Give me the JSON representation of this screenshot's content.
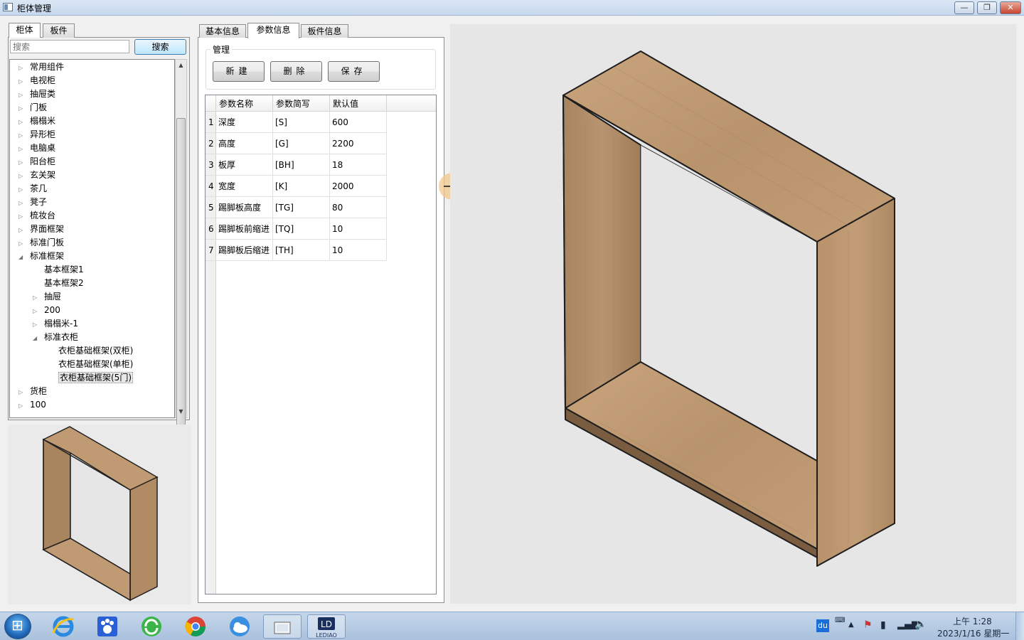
{
  "window": {
    "title": "柜体管理",
    "min_symbol": "—",
    "max_symbol": "❐",
    "close_symbol": "✕"
  },
  "left_tabs": [
    {
      "label": "柜体",
      "active": true
    },
    {
      "label": "板件",
      "active": false
    }
  ],
  "search": {
    "placeholder": "搜索",
    "button_label": "搜索"
  },
  "tree": [
    {
      "label": "常用组件",
      "level": 0,
      "state": "collapsed"
    },
    {
      "label": "电视柜",
      "level": 0,
      "state": "collapsed"
    },
    {
      "label": "抽屉类",
      "level": 0,
      "state": "collapsed"
    },
    {
      "label": "门板",
      "level": 0,
      "state": "collapsed"
    },
    {
      "label": "榻榻米",
      "level": 0,
      "state": "collapsed"
    },
    {
      "label": "异形柜",
      "level": 0,
      "state": "collapsed"
    },
    {
      "label": "电脑桌",
      "level": 0,
      "state": "collapsed"
    },
    {
      "label": "阳台柜",
      "level": 0,
      "state": "collapsed"
    },
    {
      "label": "玄关架",
      "level": 0,
      "state": "collapsed"
    },
    {
      "label": "茶几",
      "level": 0,
      "state": "collapsed"
    },
    {
      "label": "凳子",
      "level": 0,
      "state": "collapsed"
    },
    {
      "label": "梳妆台",
      "level": 0,
      "state": "collapsed"
    },
    {
      "label": "界面框架",
      "level": 0,
      "state": "collapsed"
    },
    {
      "label": "标准门板",
      "level": 0,
      "state": "collapsed"
    },
    {
      "label": "标准框架",
      "level": 0,
      "state": "expanded"
    },
    {
      "label": "基本框架1",
      "level": 1,
      "state": "leaf"
    },
    {
      "label": "基本框架2",
      "level": 1,
      "state": "leaf"
    },
    {
      "label": "抽屉",
      "level": 1,
      "state": "collapsed"
    },
    {
      "label": "200",
      "level": 1,
      "state": "collapsed"
    },
    {
      "label": "榻榻米-1",
      "level": 1,
      "state": "collapsed"
    },
    {
      "label": "标准衣柜",
      "level": 1,
      "state": "expanded"
    },
    {
      "label": "衣柜基础框架(双柜)",
      "level": 2,
      "state": "leaf"
    },
    {
      "label": "衣柜基础框架(单柜)",
      "level": 2,
      "state": "leaf"
    },
    {
      "label": "衣柜基础框架(5门)",
      "level": 2,
      "state": "leaf",
      "selected": true
    },
    {
      "label": "货柜",
      "level": 0,
      "state": "collapsed"
    },
    {
      "label": "100",
      "level": 0,
      "state": "collapsed"
    }
  ],
  "middle_tabs": [
    {
      "label": "基本信息",
      "active": false
    },
    {
      "label": "参数信息",
      "active": true
    },
    {
      "label": "板件信息",
      "active": false
    }
  ],
  "manage": {
    "group_title": "管理",
    "new_label": "新建",
    "delete_label": "删除",
    "save_label": "保存"
  },
  "param_table": {
    "columns": [
      "参数名称",
      "参数简写",
      "默认值"
    ],
    "rows": [
      {
        "num": "1",
        "name": "深度",
        "abbr": "[S]",
        "value": "600"
      },
      {
        "num": "2",
        "name": "高度",
        "abbr": "[G]",
        "value": "2200"
      },
      {
        "num": "3",
        "name": "板厚",
        "abbr": "[BH]",
        "value": "18"
      },
      {
        "num": "4",
        "name": "宽度",
        "abbr": "[K]",
        "value": "2000"
      },
      {
        "num": "5",
        "name": "踢脚板高度",
        "abbr": "[TG]",
        "value": "80"
      },
      {
        "num": "6",
        "name": "踢脚板前缩进",
        "abbr": "[TQ]",
        "value": "10"
      },
      {
        "num": "7",
        "name": "踢脚板后缩进",
        "abbr": "[TH]",
        "value": "10"
      }
    ]
  },
  "colors": {
    "wood_top": "#c09a72",
    "wood_side": "#a9855f",
    "wood_front": "#8e6e4e",
    "edge": "#2b2b2b",
    "viewport_bg": "#e6e6e6"
  },
  "taskbar": {
    "apps": [
      "ie-icon",
      "baidu-paw-icon",
      "refresh-360-icon",
      "chrome-icon",
      "cloud-icon",
      "explorer-icon",
      "ledao-icon"
    ],
    "ledao_label": "LEDIAO",
    "tray_du": "du",
    "time": "上午 1:28",
    "date": "2023/1/16 星期一"
  }
}
